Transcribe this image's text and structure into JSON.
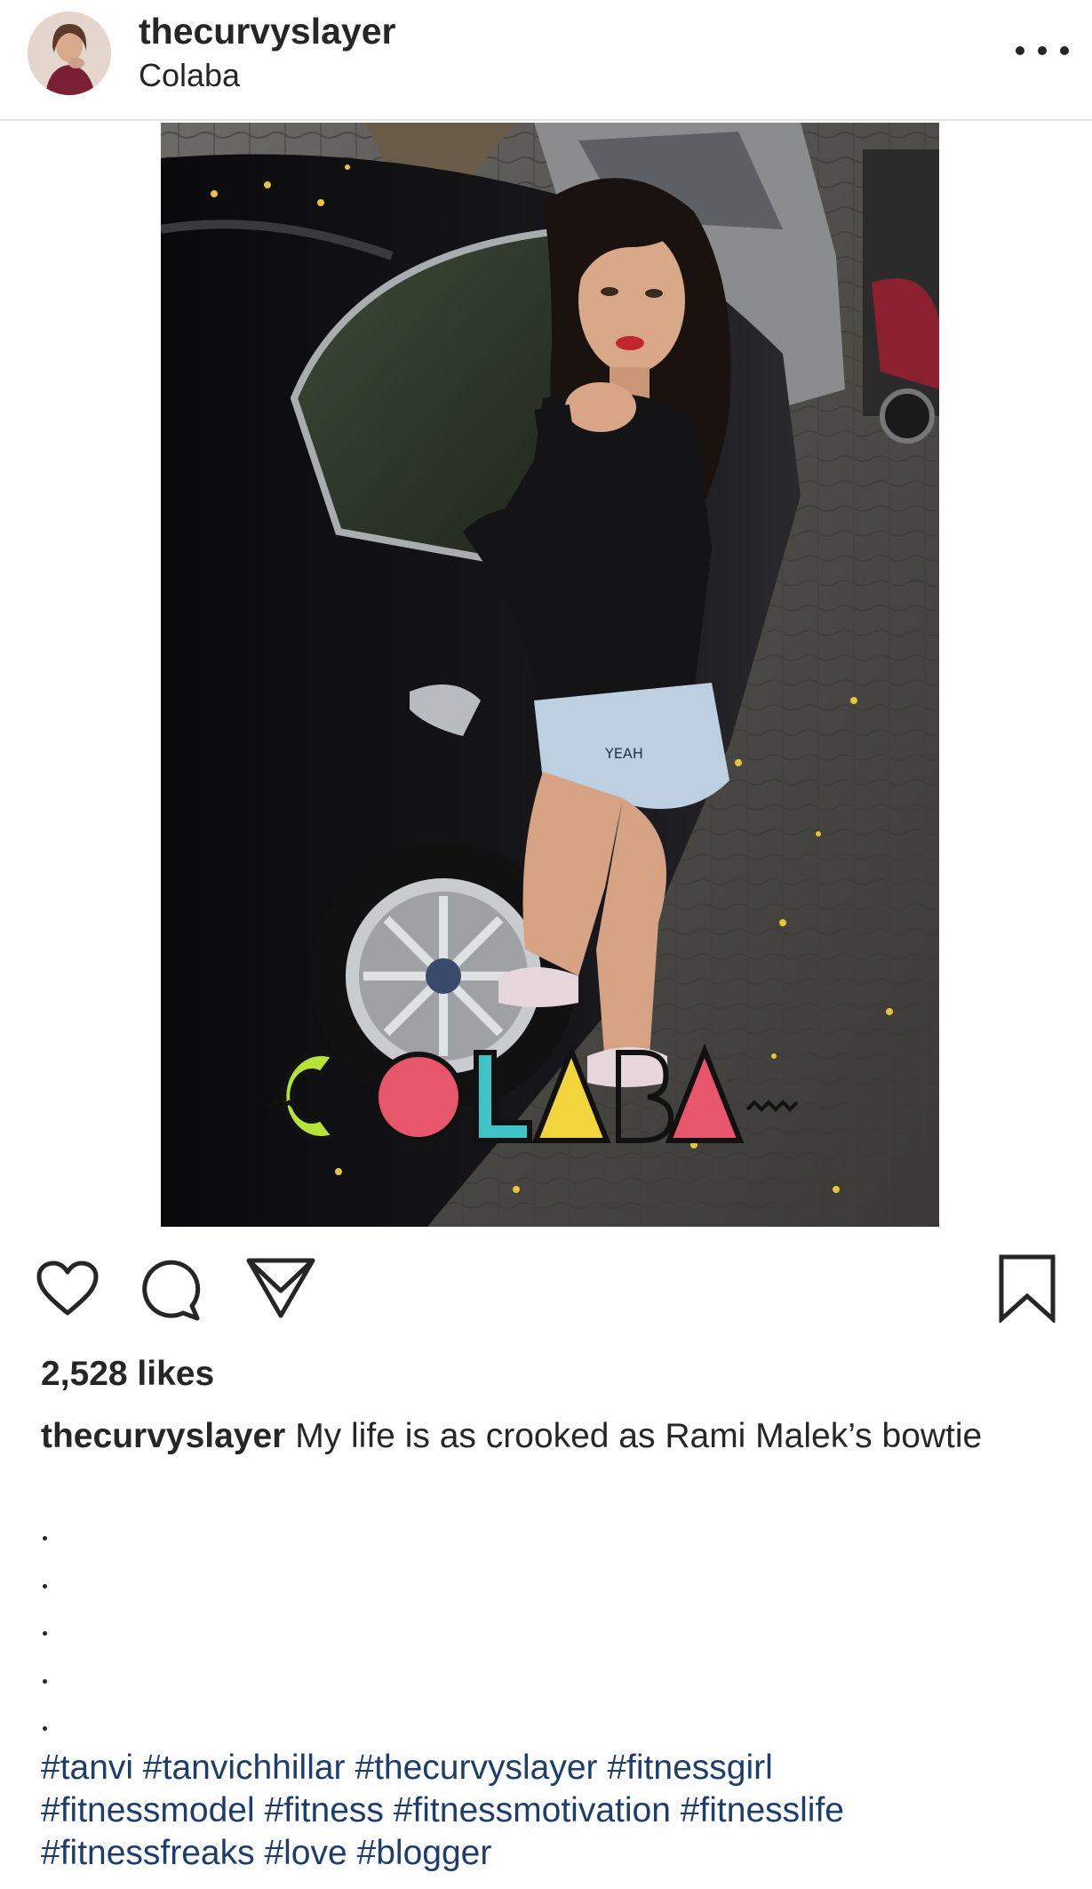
{
  "header": {
    "username": "thecurvyslayer",
    "location": "Colaba"
  },
  "photo": {
    "overlay_text": "COLABA",
    "shorts_print": "YEAH"
  },
  "actions": {
    "like_icon": "heart-icon",
    "comment_icon": "comment-icon",
    "share_icon": "paper-plane-icon",
    "save_icon": "bookmark-icon"
  },
  "likes": "2,528 likes",
  "caption": {
    "username": "thecurvyslayer",
    "text": "My life is as crooked as Rami Malek’s bowtie",
    "dots": [
      ".",
      ".",
      ".",
      ".",
      "."
    ]
  },
  "hashtags": [
    "#tanvi",
    "#tanvichhillar",
    "#thecurvyslayer",
    "#fitnessgirl",
    "#fitnessmodel",
    "#fitness",
    "#fitnessmotivation",
    "#fitnesslife",
    "#fitnessfreaks",
    "#love",
    "#blogger"
  ],
  "colors": {
    "text": "#262626",
    "hashtag": "#1d3d6e",
    "divider": "#e6e6e6",
    "overlay_green": "#b7e23a",
    "overlay_pink": "#e8566b",
    "overlay_teal": "#3fc3c7",
    "overlay_yellow": "#f2d43c"
  }
}
